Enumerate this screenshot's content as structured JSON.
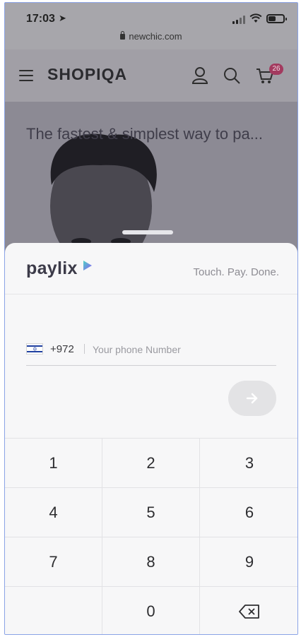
{
  "status_bar": {
    "time": "17:03",
    "location_arrow": "➤"
  },
  "browser": {
    "url": "newchic.com"
  },
  "site_header": {
    "logo": "SHOPIQA",
    "cart_count": "26",
    "icons": [
      "menu-icon",
      "account-icon",
      "search-icon",
      "cart-icon"
    ]
  },
  "hero": {
    "text": "The fastest & simplest way to pa..."
  },
  "paylix": {
    "brand": "paylix",
    "tagline": "Touch. Pay. Done.",
    "country_code": "+972",
    "phone_placeholder": "Your phone Number",
    "next_icon": "arrow-right-icon",
    "keys": [
      "1",
      "2",
      "3",
      "4",
      "5",
      "6",
      "7",
      "8",
      "9",
      "",
      "0",
      "⌫"
    ]
  },
  "colors": {
    "overlay": "#9b9aa1",
    "sheet_bg": "#f7f7f8",
    "brand_text": "#3c3b49",
    "badge": "#a33a5f",
    "brand_triangle": "#4fd1c5"
  }
}
